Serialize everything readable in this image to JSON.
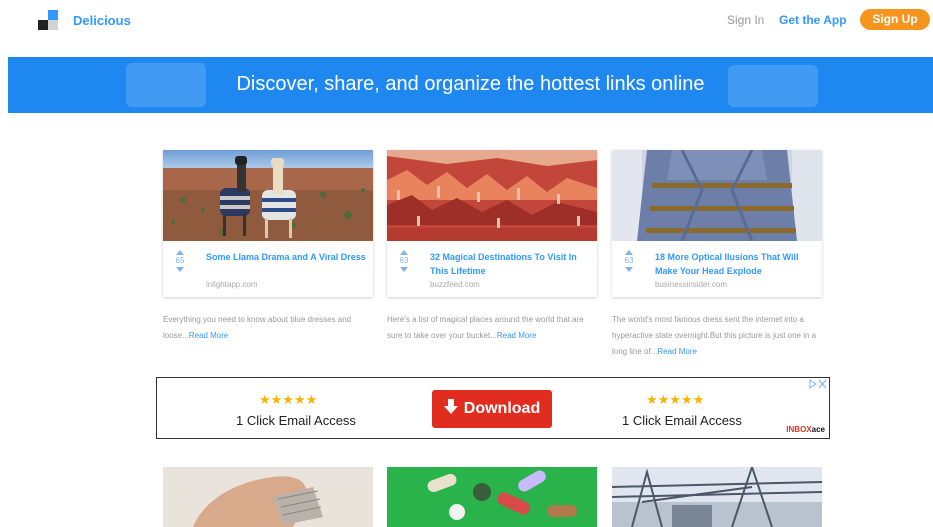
{
  "header": {
    "brand": "Delicious",
    "sign_in": "Sign In",
    "get_app": "Get the App",
    "sign_up": "Sign Up"
  },
  "banner": {
    "text": "Discover, share, and organize the hottest links online"
  },
  "cards": [
    {
      "votes": "65",
      "title": "Some Llama Drama and A Viral Dress",
      "domain": "inlightapp.com",
      "description": "Everything you need to know about blue dresses and loose...",
      "read_more": "Read More"
    },
    {
      "votes": "63",
      "title": "32 Magical Destinations To Visit In This Lifetime",
      "domain": "buzzfeed.com",
      "description": "Here's a list of magical places around the world that are sure to take over your bucket...",
      "read_more": "Read More"
    },
    {
      "votes": "63",
      "title": "18 More Optical Ilusions That Will Make Your Head Explode",
      "domain": "businessinsider.com",
      "description": "The world's most famous dress sent the internet into a hyperactive state overnight.But this picture is just one in a long line of...",
      "read_more": "Read More"
    }
  ],
  "ad": {
    "left_stars": "★★★★★",
    "left_text": "1 Click Email Access",
    "button": "Download",
    "right_stars": "★★★★★",
    "right_text": "1 Click Email Access",
    "sponsor_a": "INBOX",
    "sponsor_b": "ace"
  },
  "colors": {
    "accent": "#3399ff",
    "banner": "#1e88f0",
    "signup": "#f7941e",
    "download": "#e12d1f"
  }
}
